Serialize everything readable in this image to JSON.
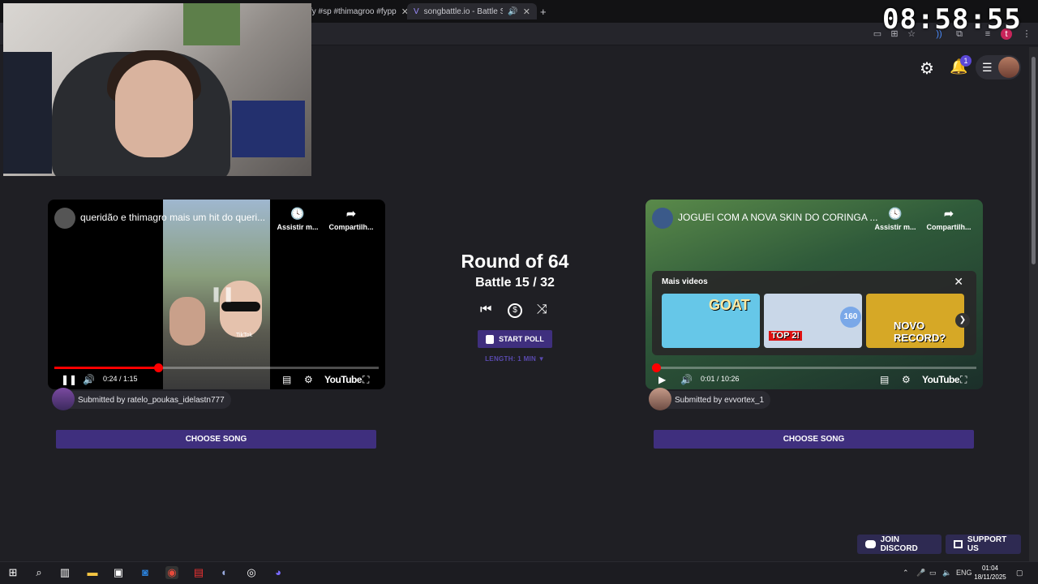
{
  "browser": {
    "tabs": [
      {
        "title": "fy #sp #thimagroo #fypp"
      },
      {
        "title": "songbattle.io - Battle Songs"
      }
    ],
    "new_tab_label": "+"
  },
  "overlay": {
    "clock": "08:58:55"
  },
  "header": {
    "notification_count": "1"
  },
  "left_video": {
    "title": "queridão e thimagro mais um hit do queri...",
    "watch_later_label": "Assistir m...",
    "share_label": "Compartilh...",
    "tiktok_watermark": "TikTok",
    "time": "0:24 / 1:15",
    "progress": 0.32,
    "brand": "YouTube",
    "submitted_by": "Submitted by ratelo_poukas_idelastn777",
    "choose_label": "CHOOSE SONG"
  },
  "right_video": {
    "title": "JOGUEI COM A NOVA SKIN DO CORINGA ...",
    "watch_later_label": "Assistir m...",
    "share_label": "Compartilh...",
    "more_videos_label": "Mais videos",
    "thumbs": [
      {
        "label": "GOAT",
        "color": "#66c7e8"
      },
      {
        "label": "TOP 2!",
        "color": "#c9d7e8"
      },
      {
        "label": "160",
        "color": "#3a6fb0"
      },
      {
        "label": "NOVO RECORD?",
        "color": "#d6a826"
      }
    ],
    "time": "0:01 / 10:26",
    "progress": 0.0,
    "brand": "YouTube",
    "submitted_by": "Submitted by evvortex_1",
    "choose_label": "CHOOSE SONG"
  },
  "center": {
    "round": "Round of 64",
    "battle": "Battle 15 / 32",
    "start_poll_label": "START POLL",
    "length_label": "LENGTH: 1 MIN ▼"
  },
  "footer": {
    "discord_label": "JOIN DISCORD",
    "support_label": "SUPPORT US"
  },
  "taskbar": {
    "lang": "ENG",
    "time": "01:04",
    "date": "18/11/2025"
  },
  "colors": {
    "accent": "#3f2f7e",
    "background": "#1f1f24",
    "progress": "#ff0000"
  }
}
